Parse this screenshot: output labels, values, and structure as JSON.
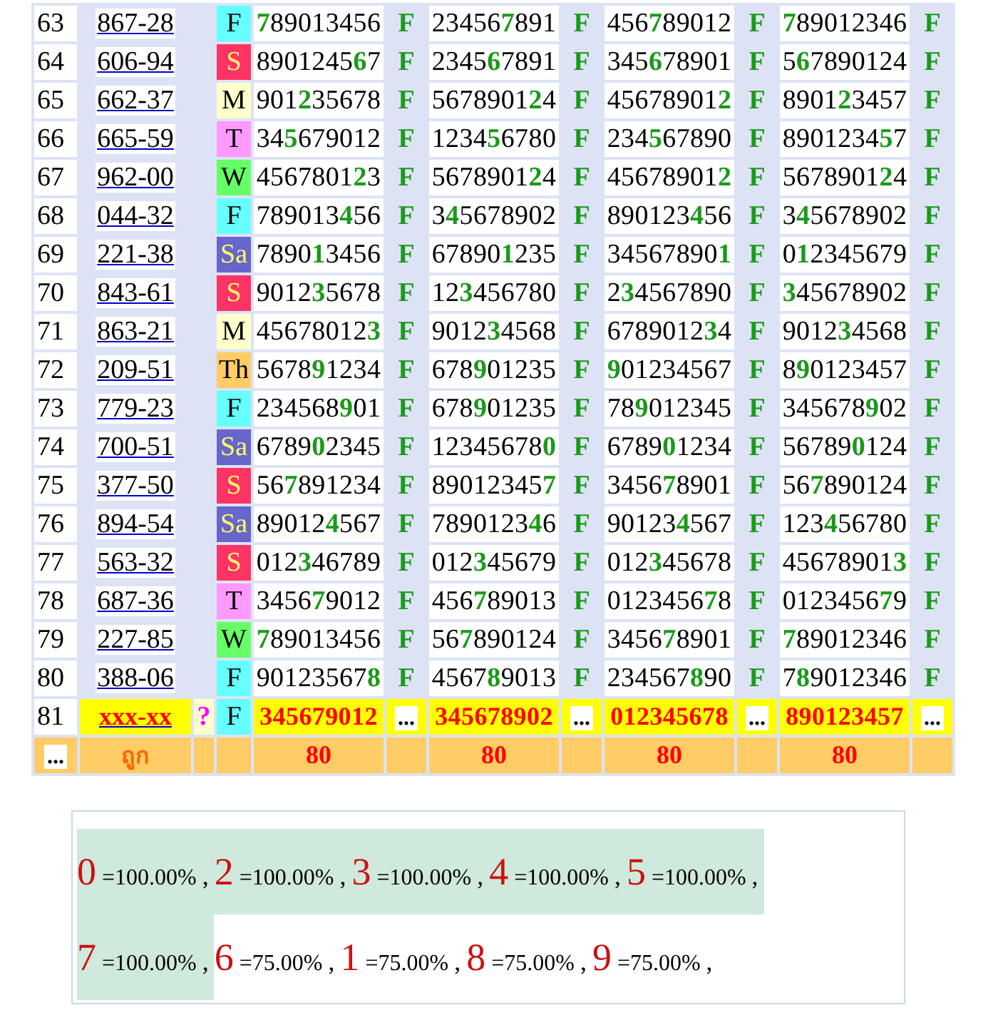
{
  "rows": [
    {
      "kind": "result",
      "number": "63",
      "code": "867-28",
      "day": {
        "label": "F",
        "color": "#66ffff"
      },
      "results": [
        {
          "value": "**7**89013456",
          "mark": "F"
        },
        {
          "value": "23456**7**891",
          "mark": "F"
        },
        {
          "value": "456**7**89012",
          "mark": "F"
        },
        {
          "value": "**7**89012346",
          "mark": "F"
        }
      ]
    },
    {
      "kind": "result",
      "number": "64",
      "code": "606-94",
      "day": {
        "label": "S",
        "color": "#ff3366"
      },
      "results": [
        {
          "value": "8901245**6**7",
          "mark": "F"
        },
        {
          "value": "2345**6**7891",
          "mark": "F"
        },
        {
          "value": "345**6**78901",
          "mark": "F"
        },
        {
          "value": "5**6**7890124",
          "mark": "F"
        }
      ]
    },
    {
      "kind": "result",
      "number": "65",
      "code": "662-37",
      "day": {
        "label": "M",
        "color": "#ffffcc"
      },
      "results": [
        {
          "value": "901**2**35678",
          "mark": "F"
        },
        {
          "value": "5678901**2**4",
          "mark": "F"
        },
        {
          "value": "45678901**2**",
          "mark": "F"
        },
        {
          "value": "8901**2**3457",
          "mark": "F"
        }
      ]
    },
    {
      "kind": "result",
      "number": "66",
      "code": "665-59",
      "day": {
        "label": "T",
        "color": "#ff99ff"
      },
      "results": [
        {
          "value": "34**5**679012",
          "mark": "F"
        },
        {
          "value": "1234**5**6780",
          "mark": "F"
        },
        {
          "value": "234**5**67890",
          "mark": "F"
        },
        {
          "value": "8901234**5**7",
          "mark": "F"
        }
      ]
    },
    {
      "kind": "result",
      "number": "67",
      "code": "962-00",
      "day": {
        "label": "W",
        "color": "#66ff66"
      },
      "results": [
        {
          "value": "4567801**2**3",
          "mark": "F"
        },
        {
          "value": "5678901**2**4",
          "mark": "F"
        },
        {
          "value": "45678901**2**",
          "mark": "F"
        },
        {
          "value": "5678901**2**4",
          "mark": "F"
        }
      ]
    },
    {
      "kind": "result",
      "number": "68",
      "code": "044-32",
      "day": {
        "label": "F",
        "color": "#66ffff"
      },
      "results": [
        {
          "value": "789013**4**56",
          "mark": "F"
        },
        {
          "value": "3**4**5678902",
          "mark": "F"
        },
        {
          "value": "890123**4**56",
          "mark": "F"
        },
        {
          "value": "3**4**5678902",
          "mark": "F"
        }
      ]
    },
    {
      "kind": "result",
      "number": "69",
      "code": "221-38",
      "day": {
        "label": "Sa",
        "color": "#6666cc"
      },
      "results": [
        {
          "value": "7890**1**3456",
          "mark": "F"
        },
        {
          "value": "67890**1**235",
          "mark": "F"
        },
        {
          "value": "34567890**1**",
          "mark": "F"
        },
        {
          "value": "0**1**2345679",
          "mark": "F"
        }
      ]
    },
    {
      "kind": "result",
      "number": "70",
      "code": "843-61",
      "day": {
        "label": "S",
        "color": "#ff3366"
      },
      "results": [
        {
          "value": "9012**3**5678",
          "mark": "F"
        },
        {
          "value": "12**3**456780",
          "mark": "F"
        },
        {
          "value": "2**3**4567890",
          "mark": "F"
        },
        {
          "value": "**3**45678902",
          "mark": "F"
        }
      ]
    },
    {
      "kind": "result",
      "number": "71",
      "code": "863-21",
      "day": {
        "label": "M",
        "color": "#ffffcc"
      },
      "results": [
        {
          "value": "45678012**3**",
          "mark": "F"
        },
        {
          "value": "9012**3**4568",
          "mark": "F"
        },
        {
          "value": "6789012**3**4",
          "mark": "F"
        },
        {
          "value": "9012**3**4568",
          "mark": "F"
        }
      ]
    },
    {
      "kind": "result",
      "number": "72",
      "code": "209-51",
      "day": {
        "label": "Th",
        "color": "#ffcc66"
      },
      "results": [
        {
          "value": "5678**9**1234",
          "mark": "F"
        },
        {
          "value": "678**9**01235",
          "mark": "F"
        },
        {
          "value": "**9**01234567",
          "mark": "F"
        },
        {
          "value": "8**9**0123457",
          "mark": "F"
        }
      ]
    },
    {
      "kind": "result",
      "number": "73",
      "code": "779-23",
      "day": {
        "label": "F",
        "color": "#66ffff"
      },
      "results": [
        {
          "value": "234568**9**01",
          "mark": "F"
        },
        {
          "value": "678**9**01235",
          "mark": "F"
        },
        {
          "value": "78**9**012345",
          "mark": "F"
        },
        {
          "value": "345678**9**02",
          "mark": "F"
        }
      ]
    },
    {
      "kind": "result",
      "number": "74",
      "code": "700-51",
      "day": {
        "label": "Sa",
        "color": "#6666cc"
      },
      "results": [
        {
          "value": "6789**0**2345",
          "mark": "F"
        },
        {
          "value": "12345678**0**",
          "mark": "F"
        },
        {
          "value": "6789**0**1234",
          "mark": "F"
        },
        {
          "value": "56789**0**124",
          "mark": "F"
        }
      ]
    },
    {
      "kind": "result",
      "number": "75",
      "code": "377-50",
      "day": {
        "label": "S",
        "color": "#ff3366"
      },
      "results": [
        {
          "value": "56**7**891234",
          "mark": "F"
        },
        {
          "value": "89012345**7**",
          "mark": "F"
        },
        {
          "value": "3456**7**8901",
          "mark": "F"
        },
        {
          "value": "56**7**890124",
          "mark": "F"
        }
      ]
    },
    {
      "kind": "result",
      "number": "76",
      "code": "894-54",
      "day": {
        "label": "Sa",
        "color": "#6666cc"
      },
      "results": [
        {
          "value": "89012**4**567",
          "mark": "F"
        },
        {
          "value": "7890123**4**6",
          "mark": "F"
        },
        {
          "value": "90123**4**567",
          "mark": "F"
        },
        {
          "value": "123**4**56780",
          "mark": "F"
        }
      ]
    },
    {
      "kind": "result",
      "number": "77",
      "code": "563-32",
      "day": {
        "label": "S",
        "color": "#ff3366"
      },
      "results": [
        {
          "value": "012**3**46789",
          "mark": "F"
        },
        {
          "value": "012**3**45679",
          "mark": "F"
        },
        {
          "value": "012**3**45678",
          "mark": "F"
        },
        {
          "value": "45678901**3**",
          "mark": "F"
        }
      ]
    },
    {
      "kind": "result",
      "number": "78",
      "code": "687-36",
      "day": {
        "label": "T",
        "color": "#ff99ff"
      },
      "results": [
        {
          "value": "3456**7**9012",
          "mark": "F"
        },
        {
          "value": "456**7**89013",
          "mark": "F"
        },
        {
          "value": "0123456**7**8",
          "mark": "F"
        },
        {
          "value": "0123456**7**9",
          "mark": "F"
        }
      ]
    },
    {
      "kind": "result",
      "number": "79",
      "code": "227-85",
      "day": {
        "label": "W",
        "color": "#66ff66"
      },
      "results": [
        {
          "value": "**7**89013456",
          "mark": "F"
        },
        {
          "value": "56**7**890124",
          "mark": "F"
        },
        {
          "value": "3456**7**8901",
          "mark": "F"
        },
        {
          "value": "**7**89012346",
          "mark": "F"
        }
      ]
    },
    {
      "kind": "result",
      "number": "80",
      "code": "388-06",
      "day": {
        "label": "F",
        "color": "#66ffff"
      },
      "results": [
        {
          "value": "90123567**8**",
          "mark": "F"
        },
        {
          "value": "4567**8**9013",
          "mark": "F"
        },
        {
          "value": "234567**8**90",
          "mark": "F"
        },
        {
          "value": "7**8**9012346",
          "mark": "F"
        }
      ]
    },
    {
      "kind": "pending",
      "number": "81",
      "code": "xxx-xx",
      "flag": "?",
      "day": {
        "label": "F",
        "color": "#66ffff"
      },
      "results": [
        {
          "value": "345679012",
          "mark": "..."
        },
        {
          "value": "345678902",
          "mark": "..."
        },
        {
          "value": "012345678",
          "mark": "..."
        },
        {
          "value": "890123457",
          "mark": "..."
        }
      ]
    }
  ],
  "footer": {
    "marker": "...",
    "label": "ถูก",
    "totals": [
      "80",
      "80",
      "80",
      "80"
    ]
  },
  "summary": [
    {
      "digit": "0",
      "percent": "=100.00%",
      "separator": ",",
      "highlighted": true
    },
    {
      "digit": "2",
      "percent": "=100.00%",
      "separator": ",",
      "highlighted": true
    },
    {
      "digit": "3",
      "percent": "=100.00%",
      "separator": ",",
      "highlighted": true
    },
    {
      "digit": "4",
      "percent": "=100.00%",
      "separator": ",",
      "highlighted": true
    },
    {
      "digit": "5",
      "percent": "=100.00%",
      "separator": ",",
      "highlighted": true
    },
    {
      "digit": "7",
      "percent": "=100.00%",
      "separator": ",",
      "highlighted": true
    },
    {
      "digit": "6",
      "percent": "=75.00%",
      "separator": ",",
      "highlighted": false
    },
    {
      "digit": "1",
      "percent": "=75.00%",
      "separator": ",",
      "highlighted": false
    },
    {
      "digit": "8",
      "percent": "=75.00%",
      "separator": ",",
      "highlighted": false
    },
    {
      "digit": "9",
      "percent": "=75.00%",
      "separator": ",",
      "highlighted": false
    }
  ]
}
